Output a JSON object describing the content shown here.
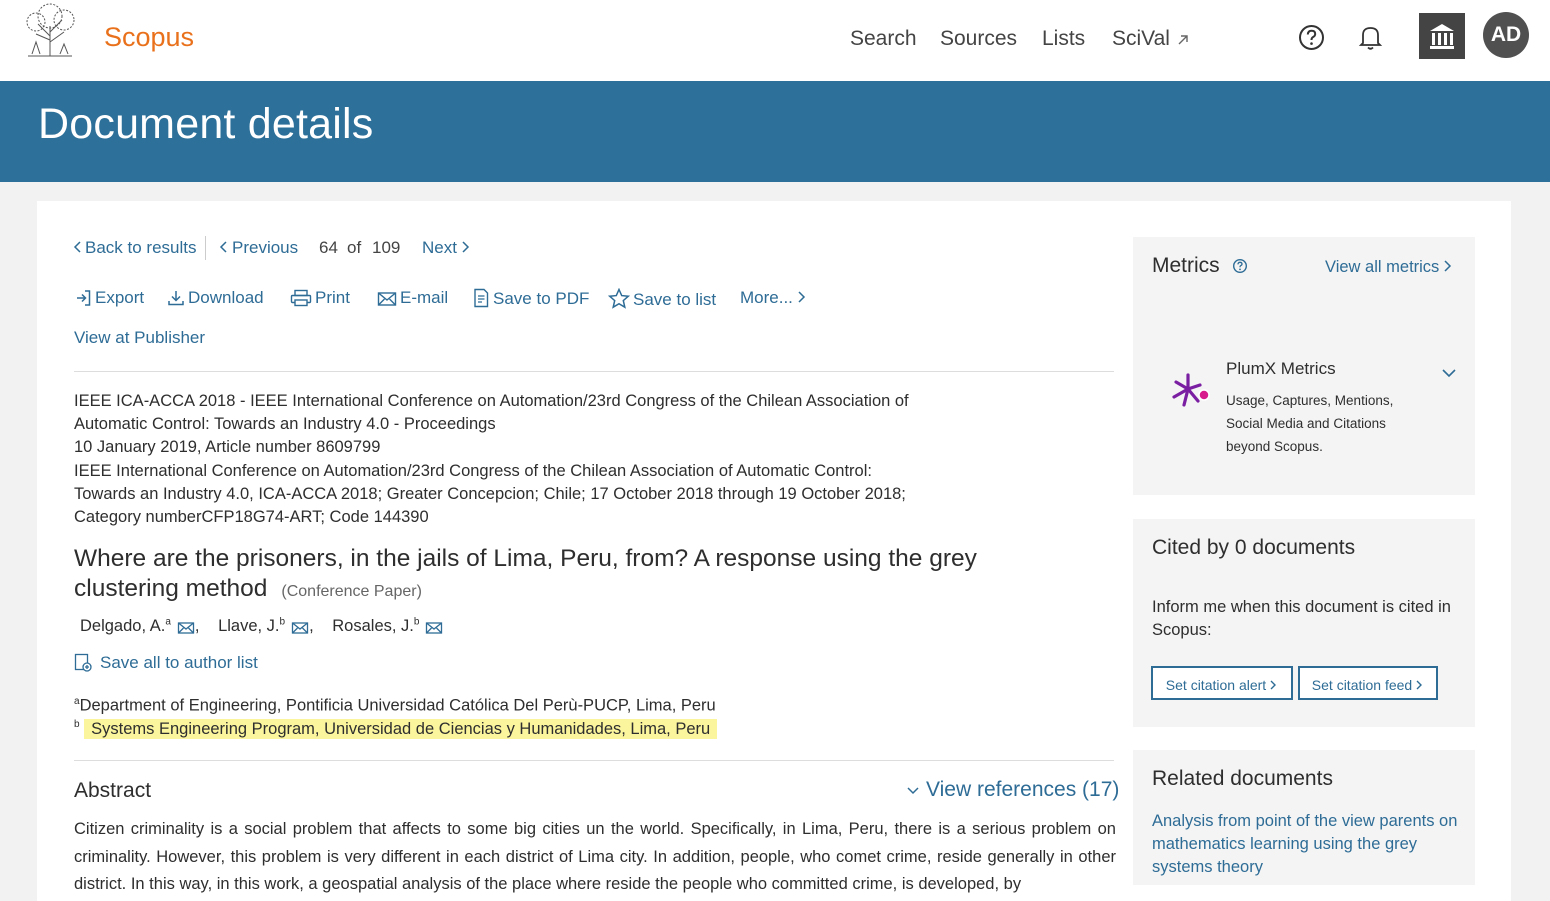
{
  "header": {
    "brand": "Scopus",
    "nav": [
      "Search",
      "Sources",
      "Lists",
      "SciVal"
    ],
    "scival_icon": "external-arrow-icon",
    "help_icon": "question-circle-icon",
    "notification_icon": "bell-icon",
    "institution_icon": "institution-icon",
    "avatar_initials": "AD"
  },
  "page_title": "Document details",
  "pager": {
    "back": "Back to results",
    "previous": "Previous",
    "current": "64",
    "of": "of",
    "total": "109",
    "next": "Next"
  },
  "toolbar": {
    "export": "Export",
    "download": "Download",
    "print": "Print",
    "email": "E-mail",
    "save_pdf": "Save to PDF",
    "save_list": "Save to list",
    "more": "More...",
    "view_publisher": "View at Publisher"
  },
  "source": {
    "line1": "IEEE ICA-ACCA 2018 - IEEE International Conference on Automation/23rd Congress of the Chilean Association of",
    "line2": "Automatic Control: Towards an Industry 4.0 - Proceedings",
    "line3": "10 January 2019, Article number 8609799",
    "line4": "IEEE International Conference on Automation/23rd Congress of the Chilean Association of Automatic Control:",
    "line5": "Towards an Industry 4.0, ICA-ACCA 2018; Greater Concepcion; Chile; 17 October 2018 through 19 October 2018;",
    "line6": "Category numberCFP18G74-ART; Code 144390"
  },
  "document": {
    "title": "Where are the prisoners, in the jails of Lima, Peru, from? A response using the grey clustering method",
    "type": "(Conference Paper)"
  },
  "authors": [
    {
      "name": "Delgado, A.",
      "sup": "a"
    },
    {
      "name": "Llave, J.",
      "sup": "b"
    },
    {
      "name": "Rosales, J.",
      "sup": "b"
    }
  ],
  "save_authors": "Save all to author list",
  "affiliations": {
    "a_sup": "a",
    "a": "Department of Engineering, Pontificia Universidad Católica Del Perù-PUCP, Lima, Peru",
    "b_sup": "b",
    "b": "Systems Engineering Program, Universidad de Ciencias y Humanidades, Lima, Peru"
  },
  "abstract": {
    "heading": "Abstract",
    "view_refs": "View references (17)",
    "text": "Citizen criminality is a social problem that affects to some big cities un the world. Specifically, in Lima, Peru, there is a serious problem on criminality. However, this problem is very different in each district of Lima city. In addition, people, who comet crime, reside generally in other district. In this way, in this work, a geospatial analysis of the place where reside the people who committed crime, is developed, by"
  },
  "metrics": {
    "title": "Metrics",
    "view_all": "View all metrics",
    "plumx_title": "PlumX Metrics",
    "plumx_desc": "Usage, Captures, Mentions, Social Media and Citations beyond Scopus.",
    "plumx_icon": "plumx-icon"
  },
  "cited": {
    "title": "Cited by 0 documents",
    "text": "Inform me when this document is cited in Scopus:",
    "alert": "Set citation alert",
    "feed": "Set citation feed"
  },
  "related": {
    "title": "Related documents",
    "link": "Analysis from point of the view parents on mathematics learning using the grey systems theory"
  },
  "colors": {
    "brand_orange": "#e9711c",
    "header_blue": "#2d7099",
    "link_blue": "#2e6c96",
    "highlight": "#fbf59e"
  }
}
